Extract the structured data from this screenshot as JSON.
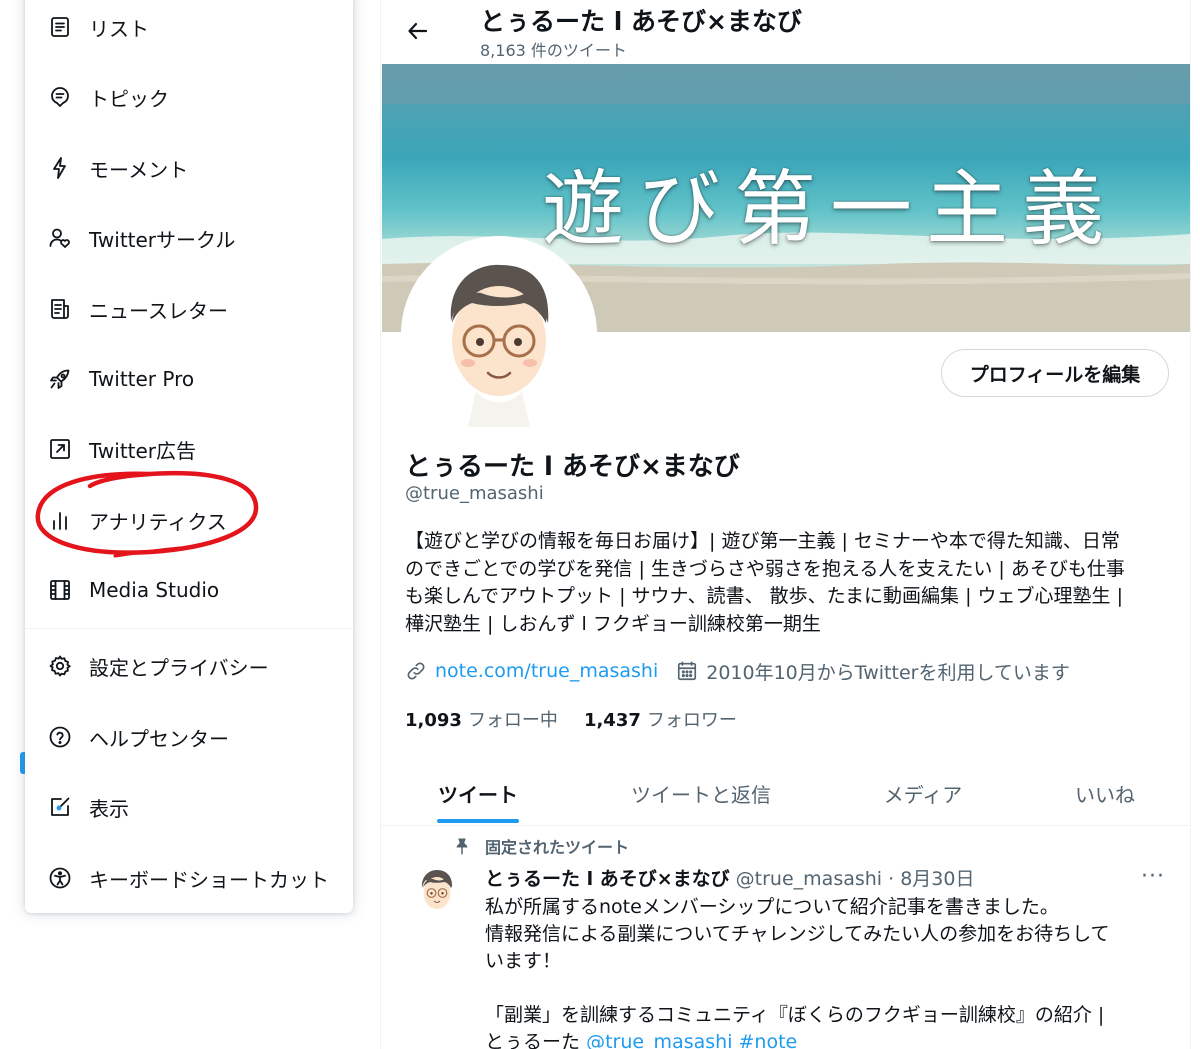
{
  "menu": {
    "items": [
      {
        "label": "リスト",
        "icon": "list-icon"
      },
      {
        "label": "トピック",
        "icon": "topic-icon"
      },
      {
        "label": "モーメント",
        "icon": "lightning-icon"
      },
      {
        "label": "Twitterサークル",
        "icon": "circle-people-icon"
      },
      {
        "label": "ニュースレター",
        "icon": "newsletter-icon"
      },
      {
        "label": "Twitter Pro",
        "icon": "rocket-icon"
      },
      {
        "label": "Twitter広告",
        "icon": "external-arrow-icon"
      },
      {
        "label": "アナリティクス",
        "icon": "bar-chart-icon"
      },
      {
        "label": "Media Studio",
        "icon": "film-icon"
      },
      {
        "label": "設定とプライバシー",
        "icon": "gear-icon"
      },
      {
        "label": "ヘルプセンター",
        "icon": "help-icon"
      },
      {
        "label": "表示",
        "icon": "display-brush-icon"
      },
      {
        "label": "キーボードショートカット",
        "icon": "accessibility-icon"
      }
    ]
  },
  "header": {
    "name": "とぅるーた l あそび×まなび",
    "tweet_count": "8,163 件のツイート"
  },
  "banner": {
    "text": "遊び第一主義"
  },
  "profile": {
    "edit_button": "プロフィールを編集",
    "name": "とぅるーた l あそび×まなび",
    "handle": "@true_masashi",
    "bio_lines": [
      "【遊びと学びの情報を毎日お届け】| 遊び第一主義 | セミナーや本で得た知識、日常",
      "のできごとでの学びを発信 | 生きづらさや弱さを抱える人を支えたい | あそびも仕事",
      "も楽しんでアウトプット | サウナ、読書、 散歩、たまに動画編集 | ウェブ心理塾生 |",
      "樺沢塾生 | しおんず l フクギョー訓練校第一期生"
    ],
    "link": "note.com/true_masashi",
    "joined": "2010年10月からTwitterを利用しています",
    "following_count": "1,093",
    "following_label": "フォロー中",
    "followers_count": "1,437",
    "followers_label": "フォロワー"
  },
  "tabs": [
    "ツイート",
    "ツイートと返信",
    "メディア",
    "いいね"
  ],
  "tweet": {
    "pinned_label": "固定されたツイート",
    "name": "とぅるーた l あそび×まなび",
    "meta": "@true_masashi · 8月30日",
    "more": "···",
    "lines": [
      "私が所属するnoteメンバーシップについて紹介記事を書きました。",
      "情報発信による副業についてチャレンジしてみたい人の参加をお待ちして",
      "います！"
    ],
    "line4": "「副業」を訓練するコミュニティ『ぼくらのフクギョー訓練校』の紹介 |",
    "line5_text": "とぅるーた",
    "line5_link": "@true_masashi #note"
  },
  "colors": {
    "accent": "#1d9bf0",
    "annotation": "#e3141b",
    "secondary_text": "#536471"
  }
}
